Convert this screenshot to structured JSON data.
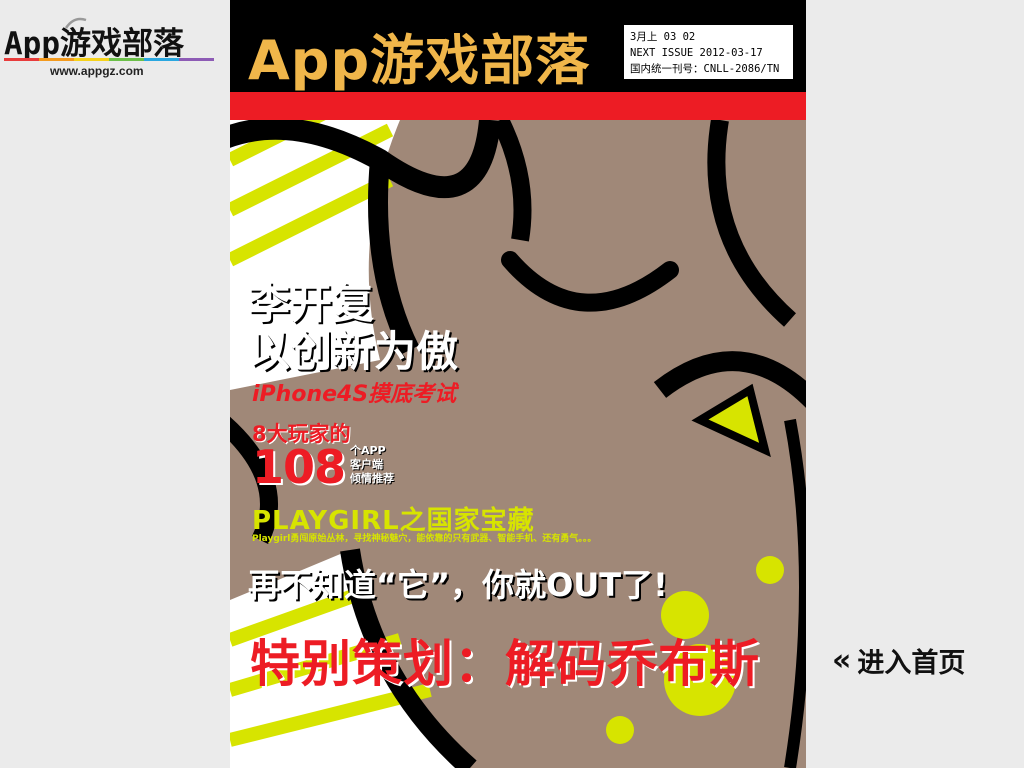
{
  "site": {
    "logo_prefix": "App",
    "logo_suffix": "游戏部落",
    "url": "www.appgz.com",
    "bar_colors": [
      "#e83c3c",
      "#f39a1e",
      "#f6d21c",
      "#6cc04a",
      "#2aa7e0",
      "#8d5bb5"
    ]
  },
  "cover": {
    "title": "App游戏部落",
    "issue": {
      "line1": "3月上 03 02",
      "line2": "NEXT ISSUE 2012-03-17",
      "line3": "国内统一刊号：CNLL-2086/TN"
    },
    "headline_1": "李开复",
    "headline_2": "以创新为傲",
    "subhead_iphone": "iPhone4S摸底考试",
    "players_line": "8大玩家的",
    "number_108": "108",
    "app_line_1": "个APP",
    "app_line_2": "客户端",
    "app_line_3": "倾情推荐",
    "playgirl_title": "PLAYGIRL之国家宝藏",
    "playgirl_desc": "Playgirl勇闯原始丛林，寻找神秘魅穴，能依靠的只有武器、智能手机、还有勇气。。。",
    "out_line": "再不知道“它”，你就OUT了!",
    "special_line": "特别策划：解码乔布斯",
    "colors": {
      "header_bg": "#000000",
      "title": "#f0b64a",
      "red_band": "#ed1c24",
      "face": "#a08878",
      "accent_yellow": "#d7e400"
    }
  },
  "nav": {
    "enter_home_icon": "double-chevron-left-icon",
    "enter_home_chevron": "«",
    "enter_home_label": "进入首页"
  }
}
